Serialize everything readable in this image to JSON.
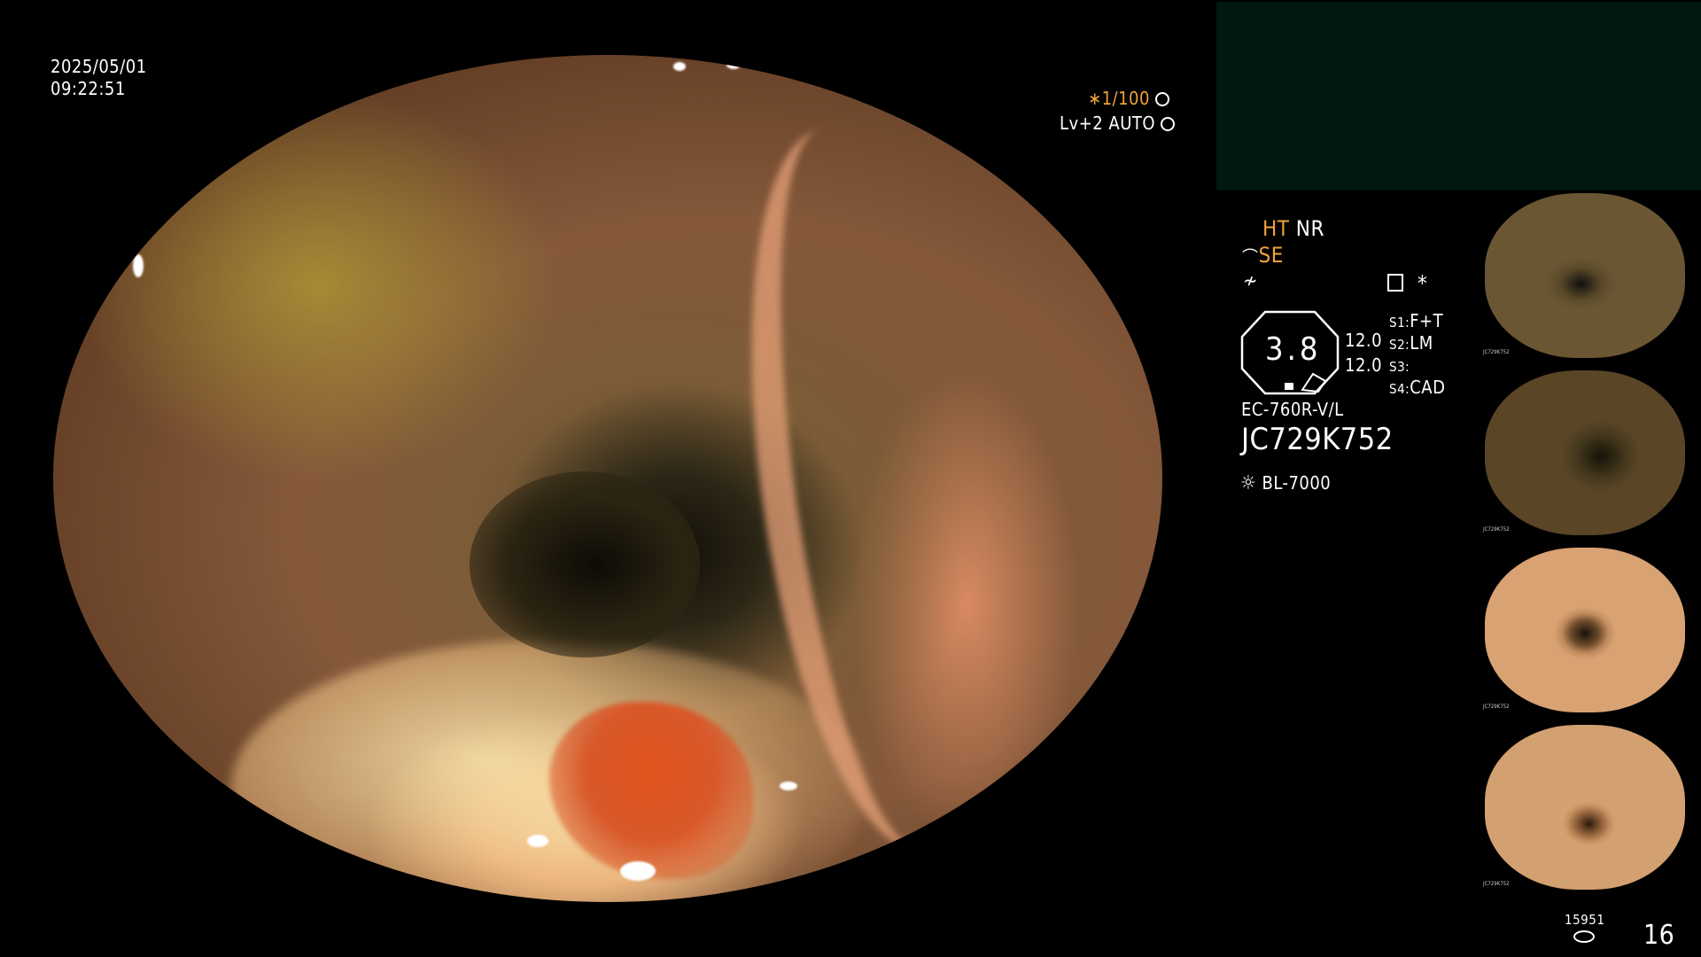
{
  "overlay": {
    "date": "2025/05/01",
    "time": "09:22:51",
    "shutter": "∗1/100",
    "level": "Lv+2 AUTO",
    "ht": "HT",
    "nr": "NR",
    "se": "SE",
    "magnification": "3.8",
    "value1": "12.0",
    "value2": "12.0",
    "s1_key": "S1:",
    "s1_val": "F+T",
    "s2_key": "S2:",
    "s2_val": "LM",
    "s3_key": "S3:",
    "s3_val": "",
    "s4_key": "S4:",
    "s4_val": "CAD",
    "scope_model": "EC-760R-V/L",
    "serial": "JC729K752",
    "light_source": "BL-7000",
    "storage_count": "15951",
    "image_count": "16",
    "asterisk": "*"
  },
  "thumbnails": [
    {
      "caption": "JC729K752"
    },
    {
      "caption": "JC729K752"
    },
    {
      "caption": "JC729K752"
    },
    {
      "caption": "JC729K752"
    }
  ],
  "colors": {
    "accent_orange": "#f0a33a",
    "panel": "#021612",
    "text": "#ffffff"
  }
}
